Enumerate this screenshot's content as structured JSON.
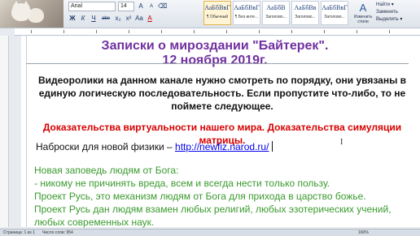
{
  "ribbon": {
    "font_name": "Arial",
    "font_size": "14",
    "font_buttons": [
      "Ж",
      "К",
      "Ч",
      "abe",
      "x₂",
      "x²",
      "Aa",
      "A"
    ],
    "styles": [
      {
        "sample": "АаБбВвГ",
        "name": "¶ Обычный"
      },
      {
        "sample": "АаБбВвГ",
        "name": "¶ Без инте..."
      },
      {
        "sample": "АаБбВ",
        "name": "Заголово..."
      },
      {
        "sample": "АаБбВв",
        "name": "Заголово..."
      },
      {
        "sample": "АаБбВвГ",
        "name": "Заголово..."
      },
      {
        "sample": "АаБбВвГ",
        "name": "Заголово..."
      }
    ],
    "change_styles": "Изменить стили",
    "edit": [
      "Найти ▾",
      "Заменить",
      "Выделить ▾"
    ]
  },
  "document": {
    "title_line1": "Записки о мироздании \"Байтерек\".",
    "title_line2": "12 ноября 2019г.",
    "intro": "Видеоролики на данном канале нужно смотреть по порядку, они увязаны в единую логическую последовательность. Если пропустите что-либо, то не поймете следующее.",
    "red_text": "Доказательства виртуальности нашего мира. Доказательства симуляции матрицы.",
    "link_prefix": "Наброски для новой физики – ",
    "link_url": "http://newfiz.narod.ru/",
    "green_lines": [
      "Новая заповедь людям от Бога:",
      "- никому не причинять вреда, всем и всегда нести только пользу.",
      "Проект Русь, это механизм людям от Бога для прихода в царство божье.",
      "Проект Русь дан людям взамен любых религий, любых эзотерических учений, любых современных наук."
    ]
  },
  "status": {
    "page": "Страница: 1 из 1",
    "words": "Число слов: 954",
    "zoom": "160%"
  },
  "colors": {
    "title": "#7030a0",
    "red": "#d60000",
    "green": "#3a9a2e",
    "link": "#0000ee"
  }
}
